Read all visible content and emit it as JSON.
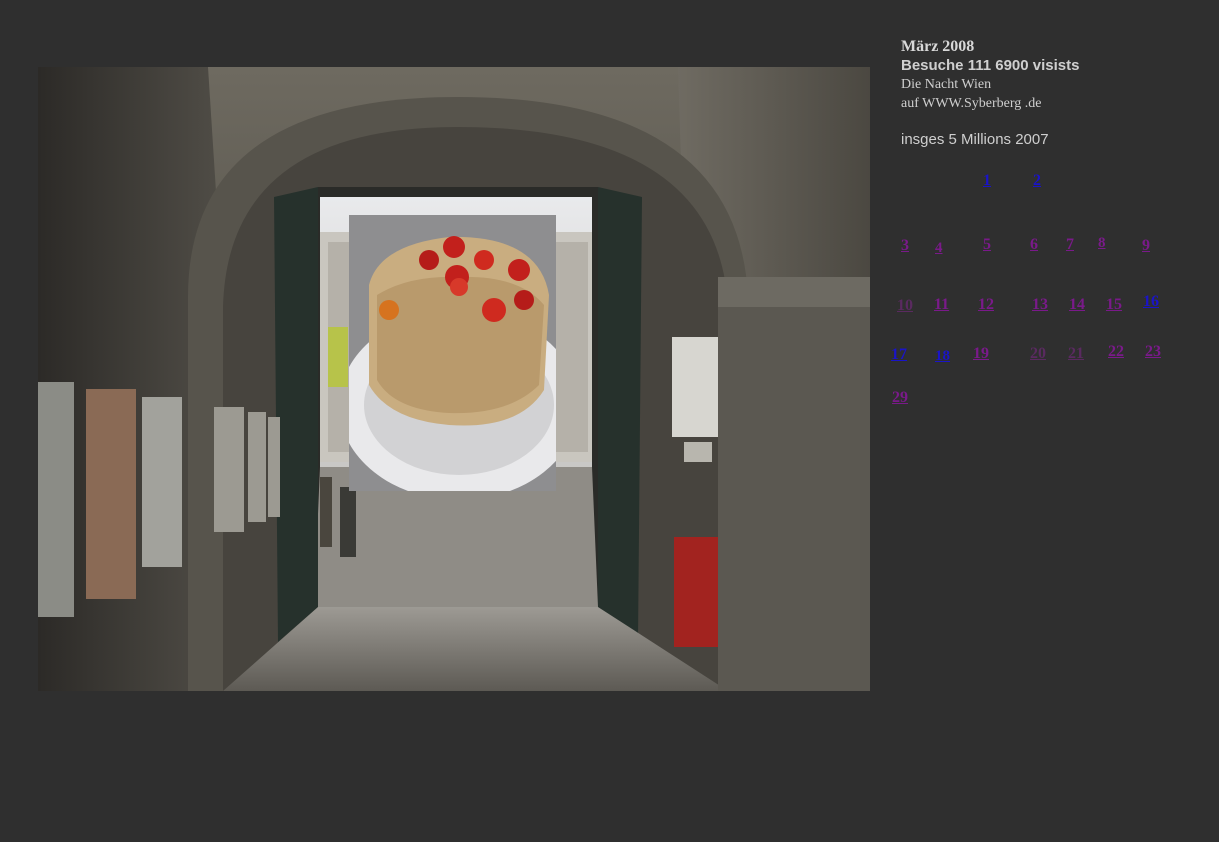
{
  "info": {
    "title": "März 2008",
    "visits": "Besuche 111 6900 visists",
    "line1": "Die Nacht Wien",
    "line2": "auf WWW.Syberberg .de",
    "total": "insges 5 Millions 2007"
  },
  "calendar": {
    "days": [
      {
        "label": "1",
        "state": "visited-new"
      },
      {
        "label": "2",
        "state": "visited-new"
      },
      {
        "label": "3",
        "state": "visited"
      },
      {
        "label": "4",
        "state": "visited"
      },
      {
        "label": "5",
        "state": "visited"
      },
      {
        "label": "6",
        "state": "visited"
      },
      {
        "label": "7",
        "state": "visited"
      },
      {
        "label": "8",
        "state": "visited"
      },
      {
        "label": "9",
        "state": "visited"
      },
      {
        "label": "10",
        "state": "dim"
      },
      {
        "label": "11",
        "state": "visited"
      },
      {
        "label": "12",
        "state": "visited"
      },
      {
        "label": "13",
        "state": "visited"
      },
      {
        "label": "14",
        "state": "visited"
      },
      {
        "label": "15",
        "state": "visited"
      },
      {
        "label": "16",
        "state": "visited-new"
      },
      {
        "label": "17",
        "state": "visited-new"
      },
      {
        "label": "18",
        "state": "visited-new"
      },
      {
        "label": "19",
        "state": "visited"
      },
      {
        "label": "20",
        "state": "dim"
      },
      {
        "label": "21",
        "state": "dim"
      },
      {
        "label": "22",
        "state": "visited"
      },
      {
        "label": "23",
        "state": "visited"
      },
      {
        "label": "29",
        "state": "visited"
      }
    ]
  },
  "colors": {
    "background": "#2f2f2f",
    "link_new": "#1a14c8",
    "link_visited": "#7a1a8a",
    "text": "#cfcfcf"
  }
}
